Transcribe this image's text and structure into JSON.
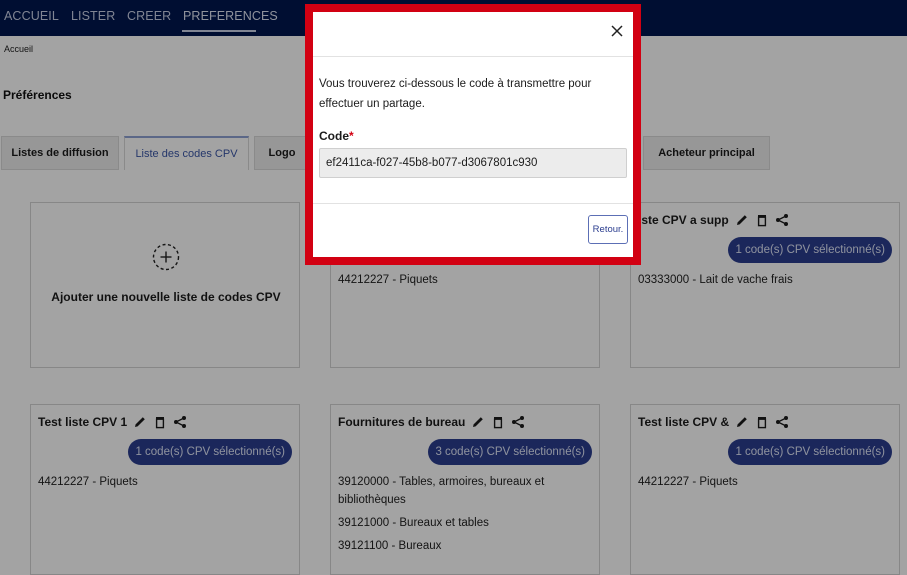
{
  "nav": {
    "items": [
      {
        "label": "ACCUEIL"
      },
      {
        "label": "LISTER"
      },
      {
        "label": "CREER"
      },
      {
        "label": "PREFERENCES"
      }
    ]
  },
  "breadcrumb": "Accueil",
  "page_title": "Préférences",
  "tabs": [
    {
      "label": "Listes de diffusion"
    },
    {
      "label": "Liste des codes CPV"
    },
    {
      "label": "Logo"
    },
    {
      "label": "Acheteur principal"
    }
  ],
  "add_card": {
    "label": "Ajouter une nouvelle liste de codes CPV"
  },
  "cards": [
    {
      "title": "",
      "badge": "",
      "codes": [
        "44212227 - Piquets"
      ]
    },
    {
      "title": "iste CPV a supp",
      "badge": "1 code(s) CPV sélectionné(s)",
      "codes": [
        "03333000 - Lait de vache frais"
      ]
    },
    {
      "title": "Test liste CPV 1",
      "badge": "1 code(s) CPV sélectionné(s)",
      "codes": [
        "44212227 - Piquets"
      ]
    },
    {
      "title": "Fournitures de bureau",
      "badge": "3 code(s) CPV sélectionné(s)",
      "codes": [
        "39120000 - Tables, armoires, bureaux et bibliothèques",
        "39121000 - Bureaux et tables",
        "39121100 - Bureaux"
      ]
    },
    {
      "title": "Test liste CPV &",
      "badge": "1 code(s) CPV sélectionné(s)",
      "codes": [
        "44212227 - Piquets"
      ]
    }
  ],
  "modal": {
    "text": "Vous trouverez ci-dessous le code à transmettre pour effectuer un partage.",
    "code_label": "Code",
    "required_mark": "*",
    "code_value": "ef2411ca-f027-45b8-b077-d3067801c930",
    "back_button": "Retour."
  },
  "colors": {
    "nav_bg": "#00164f",
    "badge_bg": "#2b3d8f",
    "modal_border": "#d20012"
  },
  "icons": [
    "pencil-icon",
    "trash-icon",
    "share-icon",
    "plus-icon",
    "close-icon"
  ]
}
